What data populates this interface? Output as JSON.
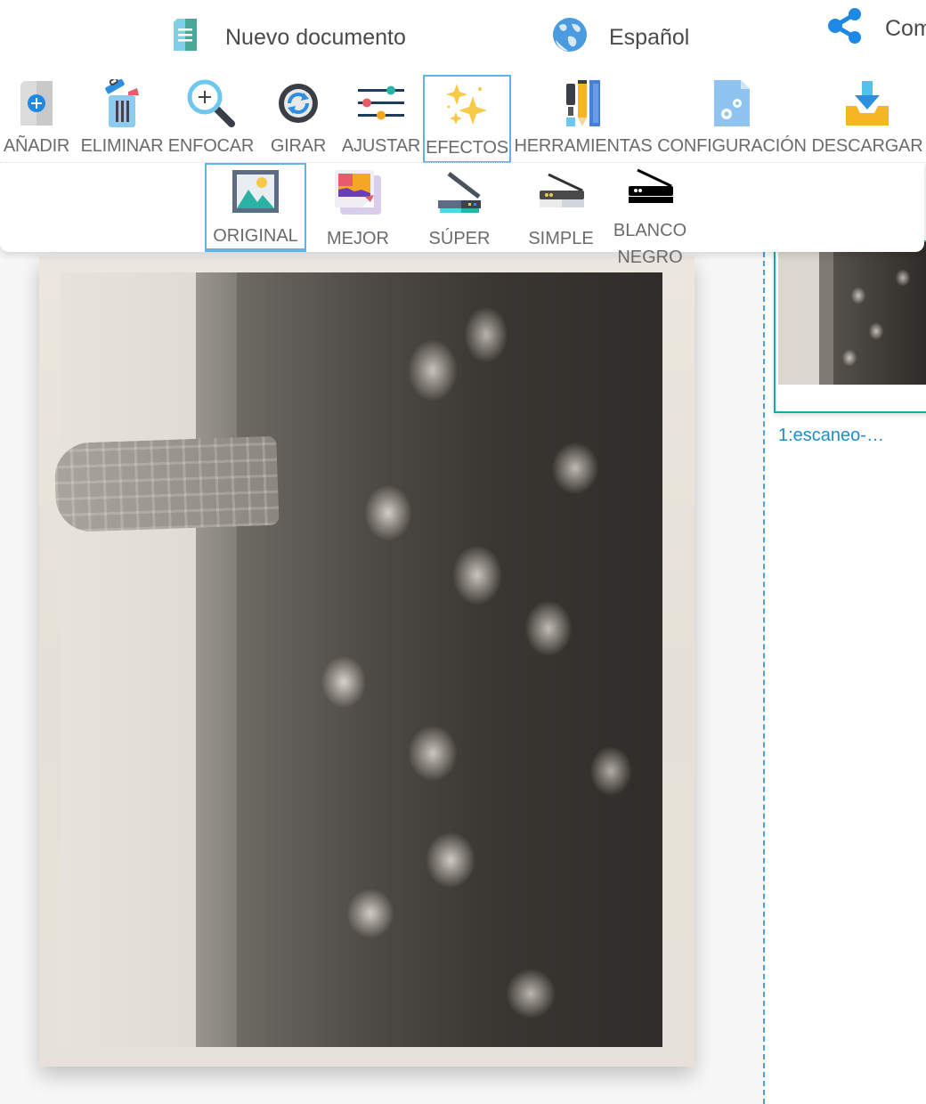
{
  "header": {
    "new_document": "Nuevo documento",
    "language": "Español",
    "share": "Com"
  },
  "toolbar": {
    "items": [
      {
        "id": "add",
        "label": "AÑADIR",
        "icon": "add-file-icon"
      },
      {
        "id": "delete",
        "label": "ELIMINAR",
        "icon": "trash-icon"
      },
      {
        "id": "zoom",
        "label": "ENFOCAR",
        "icon": "magnifier-icon"
      },
      {
        "id": "rotate",
        "label": "GIRAR",
        "icon": "rotate-icon"
      },
      {
        "id": "adjust",
        "label": "AJUSTAR",
        "icon": "sliders-icon"
      },
      {
        "id": "effects",
        "label": "EFECTOS",
        "icon": "sparkles-icon",
        "active": true
      },
      {
        "id": "tools",
        "label": "HERRAMIENTAS",
        "icon": "pencil-tools-icon"
      },
      {
        "id": "settings",
        "label": "CONFIGURACIÓN",
        "icon": "settings-file-icon"
      },
      {
        "id": "download",
        "label": "DESCARGAR",
        "icon": "download-icon"
      }
    ]
  },
  "effects": {
    "items": [
      {
        "id": "original",
        "label": "ORIGINAL",
        "icon": "picture-icon",
        "active": true
      },
      {
        "id": "better",
        "label": "MEJOR",
        "icon": "enhanced-photo-icon"
      },
      {
        "id": "super",
        "label": "SÚPER",
        "icon": "color-scanner-icon"
      },
      {
        "id": "simple",
        "label": "SIMPLE",
        "icon": "gray-scanner-icon"
      },
      {
        "id": "bw",
        "label_line1": "BLANCO",
        "label_line2": "NEGRO",
        "icon": "black-scanner-icon"
      }
    ]
  },
  "sidebar": {
    "pages": [
      {
        "label": "1:escaneo-…",
        "selected": true
      }
    ]
  },
  "colors": {
    "accent_blue": "#5db4ea",
    "selected_teal": "#1ca6a6",
    "link_blue": "#1b8fc7",
    "divider_blue": "#4a9fd6"
  }
}
